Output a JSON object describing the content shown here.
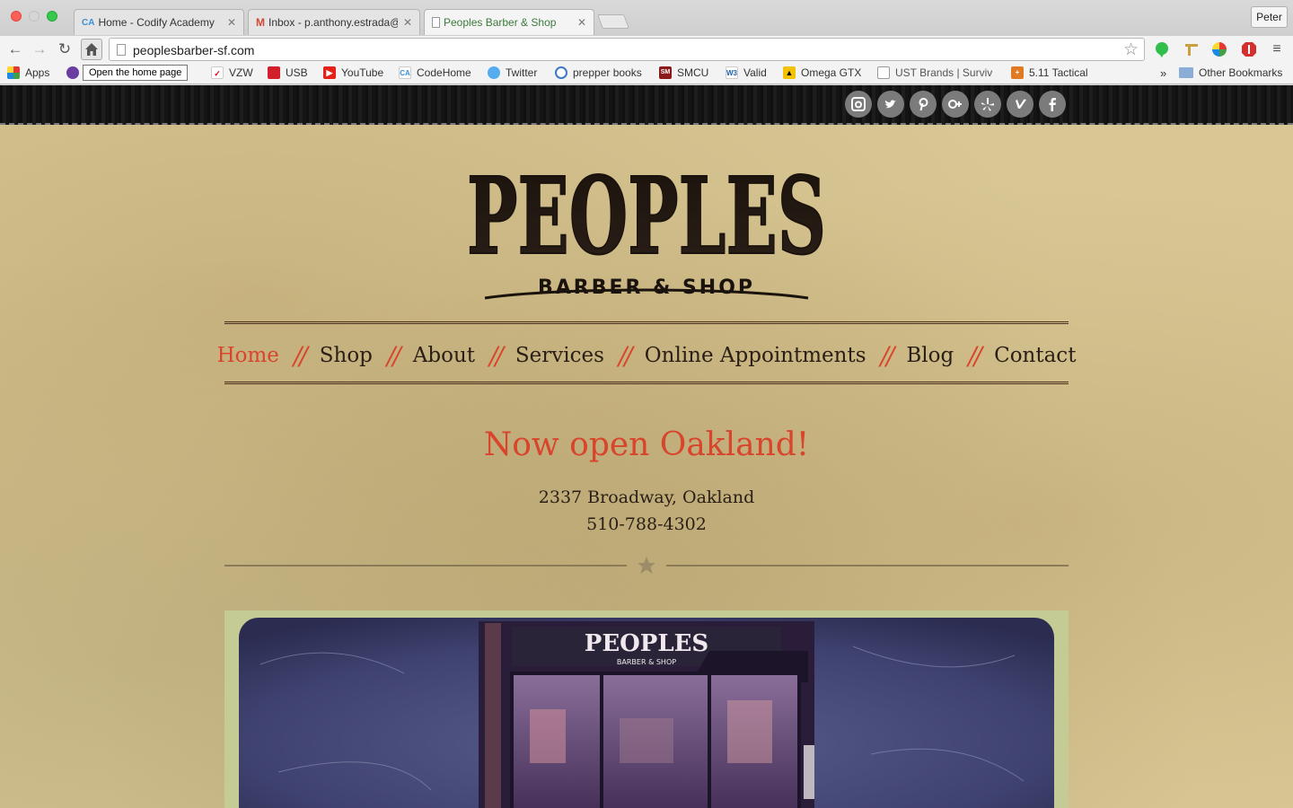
{
  "browser": {
    "tabs": [
      {
        "label": "Home - Codify Academy",
        "favicon": "CA",
        "active": false
      },
      {
        "label": "Inbox - p.anthony.estrada@",
        "favicon": "gmail",
        "active": false
      },
      {
        "label": "Peoples Barber & Shop",
        "favicon": "page",
        "active": true
      }
    ],
    "profile_name": "Peter",
    "url": "peoplesbarber-sf.com",
    "tooltip": "Open the home page",
    "bookmarks": [
      {
        "label": "Apps",
        "icon": "apps-grid-icon"
      },
      {
        "label": "VZW",
        "icon": "vzw-icon"
      },
      {
        "label": "USB",
        "icon": "usb-icon"
      },
      {
        "label": "YouTube",
        "icon": "youtube-icon"
      },
      {
        "label": "CodeHome",
        "icon": "codify-icon"
      },
      {
        "label": "Twitter",
        "icon": "twitter-icon"
      },
      {
        "label": "prepper books",
        "icon": "globe-icon"
      },
      {
        "label": "SMCU",
        "icon": "smcu-icon"
      },
      {
        "label": "Valid",
        "icon": "w3c-icon"
      },
      {
        "label": "Omega GTX",
        "icon": "warning-icon"
      },
      {
        "label": "UST Brands | Surviv",
        "icon": "page-icon"
      },
      {
        "label": "5.11 Tactical",
        "icon": "tactical-icon"
      }
    ],
    "overflow_label": "»",
    "other_bookmarks": "Other Bookmarks"
  },
  "site": {
    "social": [
      "instagram",
      "twitter",
      "pinterest",
      "google-plus",
      "yelp",
      "vimeo",
      "facebook"
    ],
    "logo_title": "PEOPLES",
    "logo_subtitle": "BARBER & SHOP",
    "nav": [
      {
        "label": "Home",
        "current": true
      },
      {
        "label": "Shop",
        "current": false
      },
      {
        "label": "About",
        "current": false
      },
      {
        "label": "Services",
        "current": false
      },
      {
        "label": "Online Appointments",
        "current": false
      },
      {
        "label": "Blog",
        "current": false
      },
      {
        "label": "Contact",
        "current": false
      }
    ],
    "nav_separator": "//",
    "headline": "Now open Oakland!",
    "address_line": "2337 Broadway, Oakland",
    "phone": "510-788-4302",
    "photo_sign_title": "PEOPLES",
    "photo_sign_subtitle": "BARBER & SHOP"
  },
  "colors": {
    "accent": "#d9442c",
    "text": "#2a1e15",
    "paper": "#d8c795"
  }
}
